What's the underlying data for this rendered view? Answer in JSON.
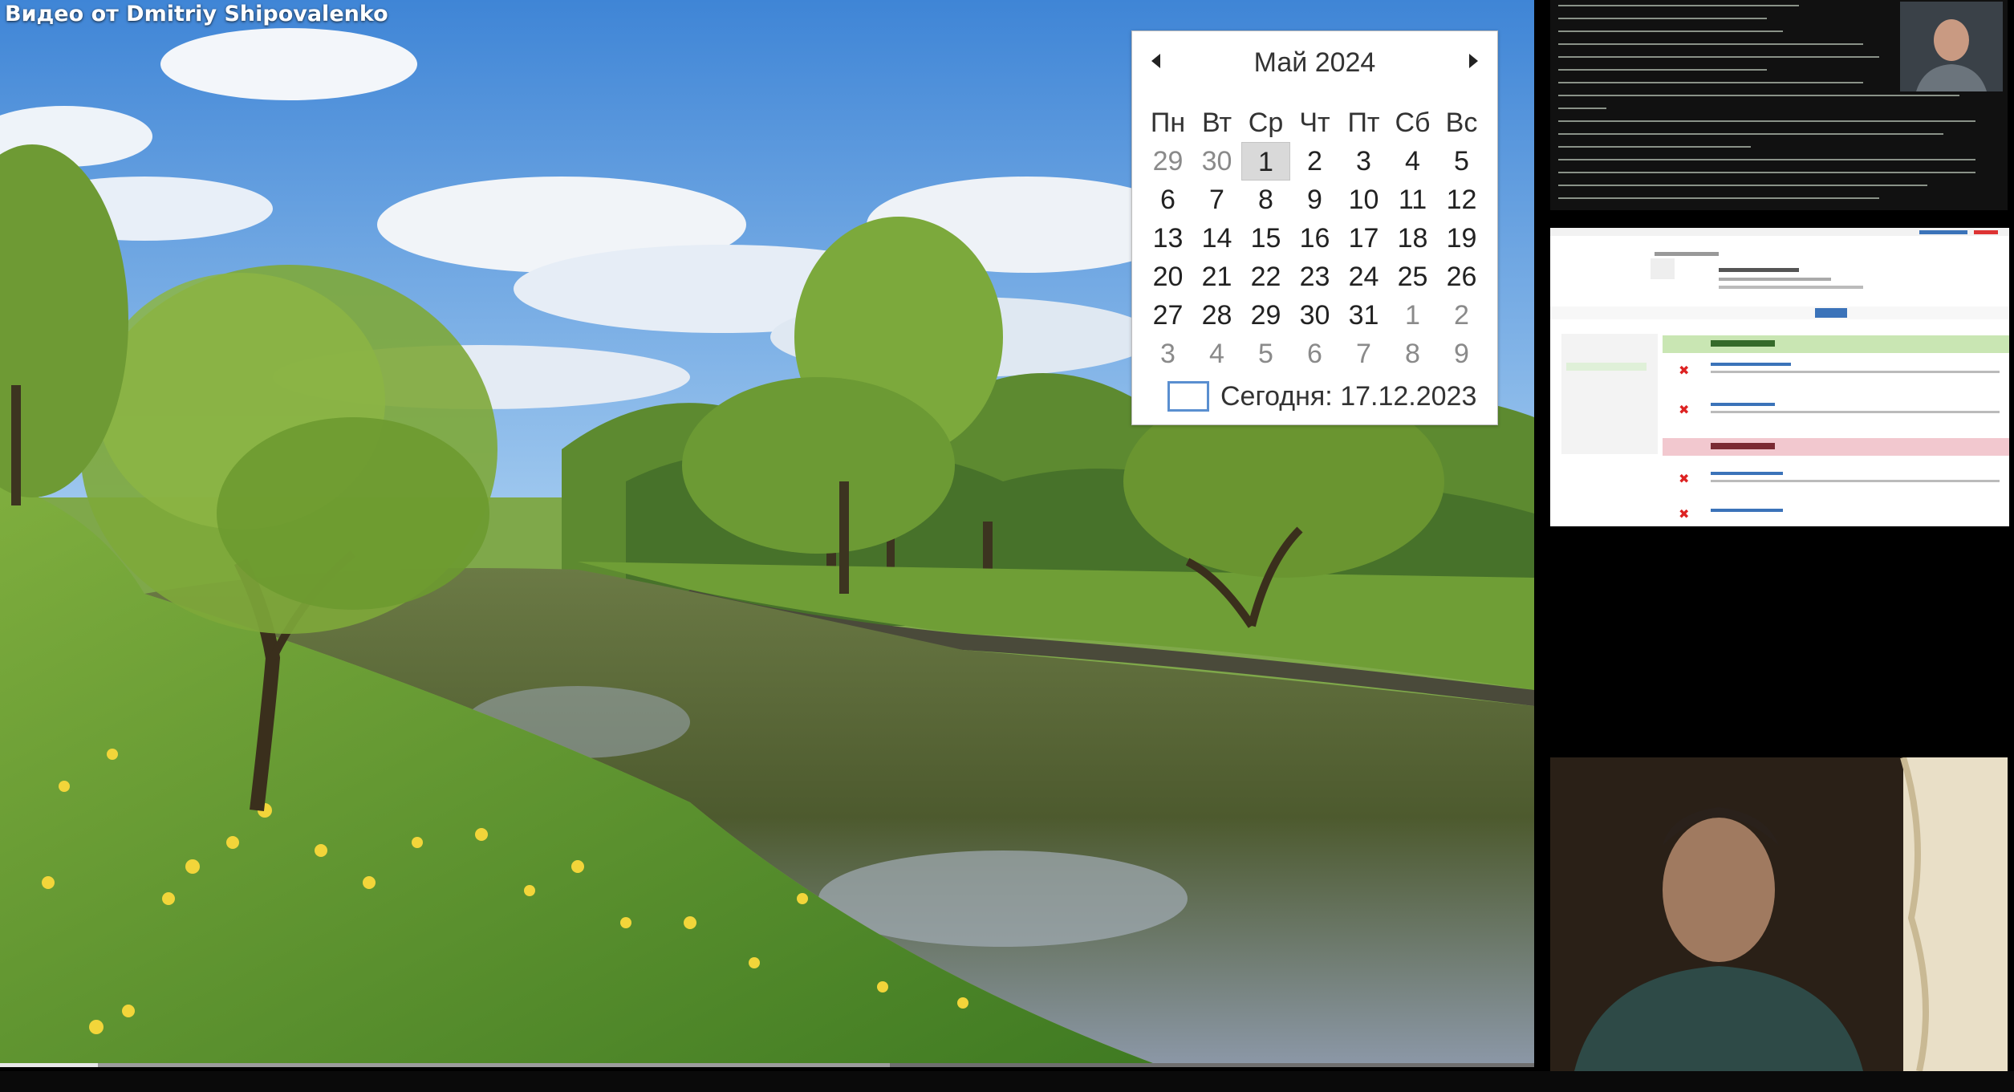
{
  "video": {
    "title": "Видео от Dmitriy Shipovalenko",
    "progress_fraction": 0.064,
    "buffer_fraction": 0.58
  },
  "calendar": {
    "month_label": "Май 2024",
    "weekdays": [
      "Пн",
      "Вт",
      "Ср",
      "Чт",
      "Пт",
      "Сб",
      "Вс"
    ],
    "weeks": [
      [
        {
          "d": "29",
          "o": true
        },
        {
          "d": "30",
          "o": true
        },
        {
          "d": "1",
          "sel": true
        },
        {
          "d": "2"
        },
        {
          "d": "3"
        },
        {
          "d": "4"
        },
        {
          "d": "5"
        }
      ],
      [
        {
          "d": "6"
        },
        {
          "d": "7"
        },
        {
          "d": "8"
        },
        {
          "d": "9"
        },
        {
          "d": "10"
        },
        {
          "d": "11"
        },
        {
          "d": "12"
        }
      ],
      [
        {
          "d": "13"
        },
        {
          "d": "14"
        },
        {
          "d": "15"
        },
        {
          "d": "16"
        },
        {
          "d": "17"
        },
        {
          "d": "18"
        },
        {
          "d": "19"
        }
      ],
      [
        {
          "d": "20"
        },
        {
          "d": "21"
        },
        {
          "d": "22"
        },
        {
          "d": "23"
        },
        {
          "d": "24"
        },
        {
          "d": "25"
        },
        {
          "d": "26"
        }
      ],
      [
        {
          "d": "27"
        },
        {
          "d": "28"
        },
        {
          "d": "29"
        },
        {
          "d": "30"
        },
        {
          "d": "31"
        },
        {
          "d": "1",
          "o": true
        },
        {
          "d": "2",
          "o": true
        }
      ],
      [
        {
          "d": "3",
          "o": true
        },
        {
          "d": "4",
          "o": true
        },
        {
          "d": "5",
          "o": true
        },
        {
          "d": "6",
          "o": true
        },
        {
          "d": "7",
          "o": true
        },
        {
          "d": "8",
          "o": true
        },
        {
          "d": "9",
          "o": true
        }
      ]
    ],
    "today_label": "Сегодня: 17.12.2023"
  },
  "colors": {
    "sky": "#4f8fd8",
    "grass": "#6f9a3a",
    "water": "#5c6a3a",
    "accent_today": "#5a8fd0"
  }
}
